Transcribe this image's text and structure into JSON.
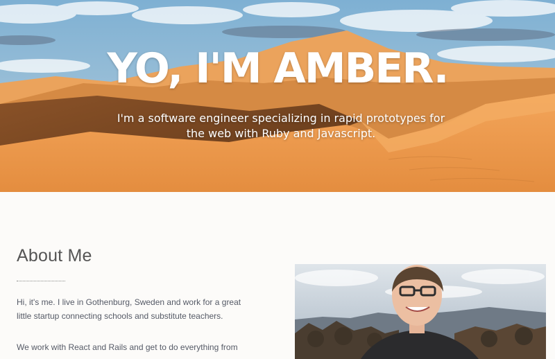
{
  "hero": {
    "title": "YO, I'M AMBER.",
    "subtitle": "I'm a software engineer specializing in rapid prototypes for the web with Ruby and Javascript."
  },
  "about": {
    "heading": "About Me",
    "paragraphs": [
      "Hi, it's me. I live in Gothenburg, Sweden and work for a great little startup connecting schools and substitute teachers.",
      "We work with React and Rails and get to do everything from"
    ]
  },
  "colors": {
    "sky": "#8ab7d6",
    "sand": "#e9974a",
    "page_background": "#fcfbf9",
    "text": "#555a66"
  }
}
